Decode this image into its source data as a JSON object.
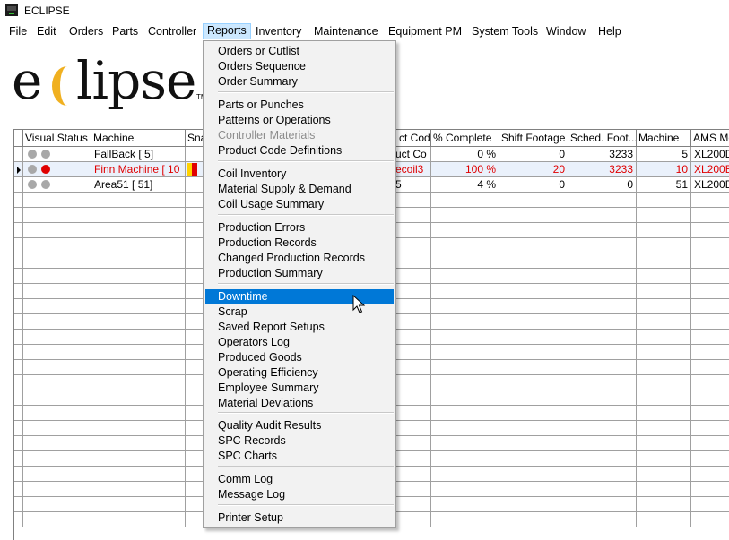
{
  "window": {
    "title": "ECLIPSE"
  },
  "menubar": [
    {
      "label": "File"
    },
    {
      "label": "Edit"
    },
    {
      "label": "Orders"
    },
    {
      "label": "Parts"
    },
    {
      "label": "Controller"
    },
    {
      "label": "Reports"
    },
    {
      "label": "Inventory"
    },
    {
      "label": "Maintenance"
    },
    {
      "label": "Equipment PM"
    },
    {
      "label": "System Tools"
    },
    {
      "label": "Window"
    },
    {
      "label": "Help"
    }
  ],
  "logo": {
    "part1": "e",
    "part2": "lipse",
    "tm": "TM"
  },
  "grid": {
    "headers": [
      "Visual Status",
      "Machine",
      "Sna",
      "",
      "",
      "",
      "ct Code",
      "% Complete",
      "Shift Footage",
      "Sched. Foot...",
      "Machine",
      "AMS Mo"
    ],
    "rows": [
      {
        "machine": "FallBack  [ 5]",
        "code": "uct Co",
        "complete": "0  %",
        "shift": "0",
        "sched": "3233",
        "mach": "5",
        "ams": "XL200D",
        "red": false,
        "selected": false,
        "leds": [
          "gray",
          "gray"
        ]
      },
      {
        "machine": "Finn Machine   [ 10",
        "code": "ecoil3",
        "complete": "100 %",
        "shift": "20",
        "sched": "3233",
        "mach": "10",
        "ams": "XL200E",
        "red": true,
        "selected": true,
        "leds": [
          "gray",
          "red"
        ]
      },
      {
        "machine": "Area51  [ 51]",
        "code": "5",
        "complete": "4  %",
        "shift": "0",
        "sched": "0",
        "mach": "51",
        "ams": "XL200E",
        "red": false,
        "selected": false,
        "leds": [
          "gray",
          "gray"
        ]
      }
    ]
  },
  "reports_menu": {
    "items": [
      {
        "label": "Orders or Cutlist"
      },
      {
        "label": "Orders Sequence"
      },
      {
        "label": "Order Summary"
      },
      {
        "label": "Parts or Punches"
      },
      {
        "label": "Patterns or Operations"
      },
      {
        "label": "Controller Materials",
        "disabled": true
      },
      {
        "label": "Product Code Definitions"
      },
      {
        "label": "Coil Inventory"
      },
      {
        "label": "Material Supply & Demand"
      },
      {
        "label": "Coil Usage Summary"
      },
      {
        "label": "Production Errors"
      },
      {
        "label": "Production Records"
      },
      {
        "label": "Changed Production Records"
      },
      {
        "label": "Production Summary"
      },
      {
        "label": "Downtime",
        "highlighted": true
      },
      {
        "label": "Scrap"
      },
      {
        "label": "Saved Report Setups"
      },
      {
        "label": "Operators Log"
      },
      {
        "label": "Produced Goods"
      },
      {
        "label": "Operating Efficiency"
      },
      {
        "label": "Employee Summary"
      },
      {
        "label": "Material Deviations"
      },
      {
        "label": "Quality Audit Results"
      },
      {
        "label": "SPC Records"
      },
      {
        "label": "SPC Charts"
      },
      {
        "label": "Comm Log"
      },
      {
        "label": "Message Log"
      },
      {
        "label": "Printer Setup"
      }
    ]
  }
}
